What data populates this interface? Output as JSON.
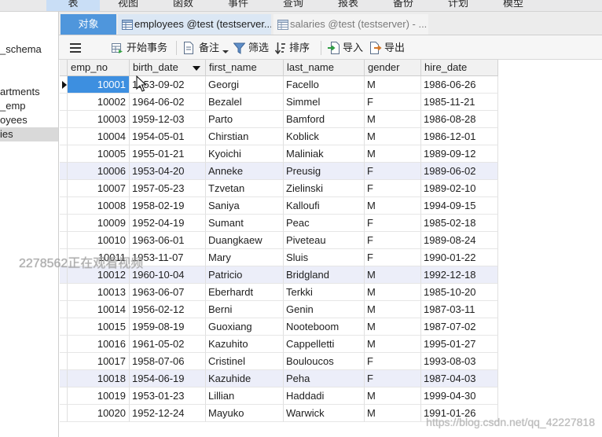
{
  "menu": {
    "items": [
      {
        "label": "表"
      },
      {
        "label": "视图"
      },
      {
        "label": "函数"
      },
      {
        "label": "事件"
      },
      {
        "label": "查询"
      },
      {
        "label": "报表"
      },
      {
        "label": "备份"
      },
      {
        "label": "计划"
      },
      {
        "label": "模型"
      }
    ],
    "active_index": 0
  },
  "sidebar": {
    "items": [
      {
        "label": "_schema"
      },
      {
        "label": "artments"
      },
      {
        "label": "_emp"
      },
      {
        "label": "oyees"
      },
      {
        "label": "ies"
      }
    ],
    "selected_index": 4
  },
  "tabs": [
    {
      "label": "对象",
      "active": true
    },
    {
      "label": "employees @test (testserver...",
      "icon": "table-icon"
    },
    {
      "label": "salaries @test (testserver) - ...",
      "icon": "table-icon"
    }
  ],
  "toolbar": {
    "menu_icon": "hamburger-icon",
    "begin_transaction": {
      "label": "开始事务",
      "icon": "begin-transaction-icon"
    },
    "memo": {
      "label": "备注",
      "icon": "memo-icon"
    },
    "filter": {
      "label": "筛选",
      "icon": "filter-icon"
    },
    "sort": {
      "label": "排序",
      "icon": "sort-icon"
    },
    "import": {
      "label": "导入",
      "icon": "import-icon"
    },
    "export": {
      "label": "导出",
      "icon": "export-icon"
    }
  },
  "grid": {
    "columns": [
      {
        "label": "emp_no"
      },
      {
        "label": "birth_date",
        "header_icon": "column-dropdown-arrow-icon"
      },
      {
        "label": "first_name"
      },
      {
        "label": "last_name"
      },
      {
        "label": "gender"
      },
      {
        "label": "hire_date"
      }
    ],
    "rows": [
      [
        "10001",
        "1953-09-02",
        "Georgi",
        "Facello",
        "M",
        "1986-06-26"
      ],
      [
        "10002",
        "1964-06-02",
        "Bezalel",
        "Simmel",
        "F",
        "1985-11-21"
      ],
      [
        "10003",
        "1959-12-03",
        "Parto",
        "Bamford",
        "M",
        "1986-08-28"
      ],
      [
        "10004",
        "1954-05-01",
        "Chirstian",
        "Koblick",
        "M",
        "1986-12-01"
      ],
      [
        "10005",
        "1955-01-21",
        "Kyoichi",
        "Maliniak",
        "M",
        "1989-09-12"
      ],
      [
        "10006",
        "1953-04-20",
        "Anneke",
        "Preusig",
        "F",
        "1989-06-02"
      ],
      [
        "10007",
        "1957-05-23",
        "Tzvetan",
        "Zielinski",
        "F",
        "1989-02-10"
      ],
      [
        "10008",
        "1958-02-19",
        "Saniya",
        "Kalloufi",
        "M",
        "1994-09-15"
      ],
      [
        "10009",
        "1952-04-19",
        "Sumant",
        "Peac",
        "F",
        "1985-02-18"
      ],
      [
        "10010",
        "1963-06-01",
        "Duangkaew",
        "Piveteau",
        "F",
        "1989-08-24"
      ],
      [
        "10011",
        "1953-11-07",
        "Mary",
        "Sluis",
        "F",
        "1990-01-22"
      ],
      [
        "10012",
        "1960-10-04",
        "Patricio",
        "Bridgland",
        "M",
        "1992-12-18"
      ],
      [
        "10013",
        "1963-06-07",
        "Eberhardt",
        "Terkki",
        "M",
        "1985-10-20"
      ],
      [
        "10014",
        "1956-02-12",
        "Berni",
        "Genin",
        "M",
        "1987-03-11"
      ],
      [
        "10015",
        "1959-08-19",
        "Guoxiang",
        "Nooteboom",
        "M",
        "1987-07-02"
      ],
      [
        "10016",
        "1961-05-02",
        "Kazuhito",
        "Cappelletti",
        "M",
        "1995-01-27"
      ],
      [
        "10017",
        "1958-07-06",
        "Cristinel",
        "Bouloucos",
        "F",
        "1993-08-03"
      ],
      [
        "10018",
        "1954-06-19",
        "Kazuhide",
        "Peha",
        "F",
        "1987-04-03"
      ],
      [
        "10019",
        "1953-01-23",
        "Lillian",
        "Haddadi",
        "M",
        "1999-04-30"
      ],
      [
        "10020",
        "1952-12-24",
        "Mayuko",
        "Warwick",
        "M",
        "1991-01-26"
      ]
    ],
    "current_row": 0,
    "selected_cell": {
      "row": 0,
      "column": 0
    }
  },
  "overlay": {
    "viewer_notice": "2278562正在观看视频",
    "watermark": "https://blog.csdn.net/qq_42227818"
  },
  "colors": {
    "selection": "#3d8fe0",
    "active_tab": "#4f96dc",
    "menu_active": "#c9def6"
  }
}
